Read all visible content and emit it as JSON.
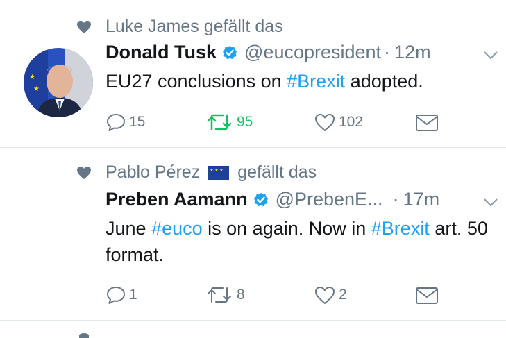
{
  "tweets": [
    {
      "liked_by": "Luke James gefällt das",
      "name": "Donald Tusk",
      "handle": "@eucopresident",
      "dot": "·",
      "time": "12m",
      "text_parts": [
        {
          "t": "EU27 conclusions on ",
          "tag": false
        },
        {
          "t": "#Brexit",
          "tag": true
        },
        {
          "t": " adopted.",
          "tag": false
        }
      ],
      "reply_count": "15",
      "retweet_count": "95",
      "like_count": "102",
      "retweeted": true
    },
    {
      "liked_by_name": "Pablo Pérez",
      "liked_by_suffix": "gefällt das",
      "name": "Preben Aamann",
      "handle": "@PrebenE...",
      "dot": "·",
      "time": "17m",
      "text_parts": [
        {
          "t": "June ",
          "tag": false
        },
        {
          "t": "#euco",
          "tag": true
        },
        {
          "t": " is on again. Now in ",
          "tag": false
        },
        {
          "t": "#Brexit",
          "tag": true
        },
        {
          "t": " art. 50 format.",
          "tag": false
        }
      ],
      "reply_count": "1",
      "retweet_count": "8",
      "like_count": "2",
      "retweeted": false
    }
  ],
  "colors": {
    "accent": "#1da1f2",
    "retweet": "#17bf63",
    "muted": "#657786",
    "divider": "#e1e8ed"
  }
}
